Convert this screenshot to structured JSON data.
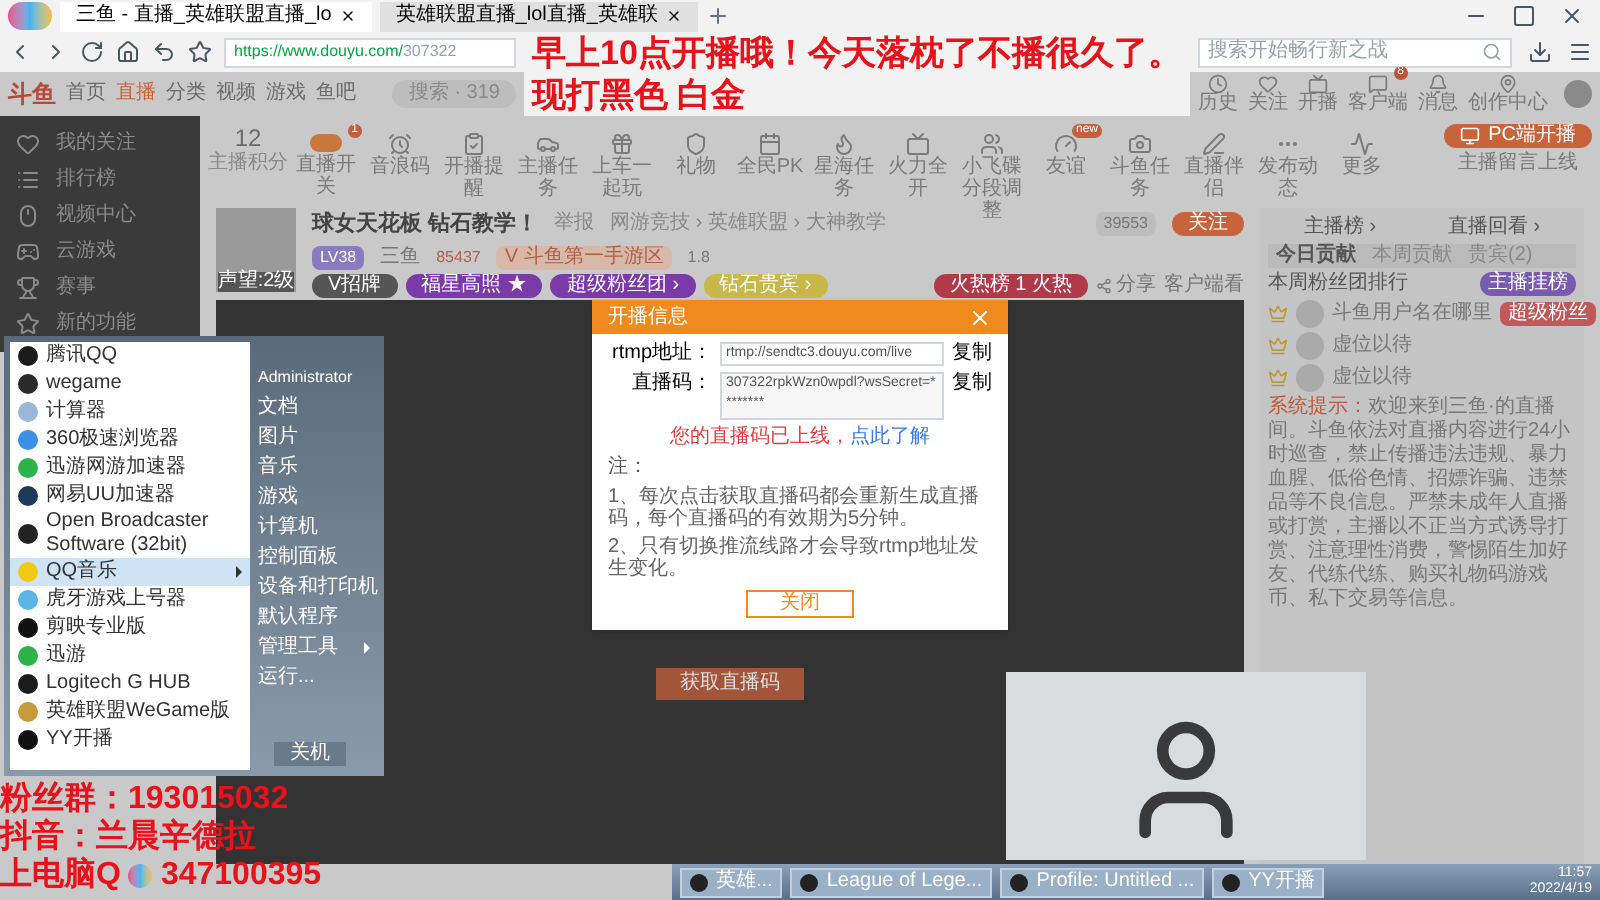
{
  "browser": {
    "tabs": [
      {
        "label": "三鱼 - 直播_英雄联盟直播_lo",
        "selected": true
      },
      {
        "label": "英雄联盟直播_lol直播_英雄联",
        "selected": false
      }
    ],
    "address_host": "https://www.douyu.com/",
    "address_path": "307322",
    "search_placeholder": "搜索开始畅行新之战"
  },
  "site": {
    "logo": "斗鱼",
    "nav": [
      {
        "label": "首页",
        "selected": false
      },
      {
        "label": "直播",
        "selected": true
      },
      {
        "label": "分类",
        "selected": false
      },
      {
        "label": "视频",
        "selected": false
      },
      {
        "label": "游戏",
        "selected": false
      },
      {
        "label": "鱼吧",
        "selected": false
      }
    ],
    "search_placeholder": "搜索 · 319",
    "user_tools": [
      {
        "label": "历史"
      },
      {
        "label": "关注"
      },
      {
        "label": "开播"
      },
      {
        "label": "客户端",
        "badge": "8"
      },
      {
        "label": "消息"
      },
      {
        "label": "创作中心"
      }
    ]
  },
  "sidebar": [
    "我的关注",
    "排行榜",
    "视频中心",
    "云游戏",
    "赛事",
    "新的功能"
  ],
  "points": {
    "value": "12",
    "label": "主播积分"
  },
  "tools": [
    {
      "kind": "toggle",
      "label": "直播开关",
      "badge": "1"
    },
    {
      "kind": "icon",
      "label": "音浪码"
    },
    {
      "kind": "icon",
      "label": "开播提醒"
    },
    {
      "kind": "icon",
      "label": "主播任务"
    },
    {
      "kind": "icon",
      "label": "上车一起玩"
    },
    {
      "kind": "icon",
      "label": "礼物"
    },
    {
      "kind": "icon",
      "label": "全民PK"
    },
    {
      "kind": "icon",
      "label": "星海任务"
    },
    {
      "kind": "icon",
      "label": "火力全开"
    },
    {
      "kind": "icon",
      "label": "小飞碟分段调整"
    },
    {
      "kind": "icon",
      "label": "友谊",
      "badge": "new"
    },
    {
      "kind": "icon",
      "label": "斗鱼任务"
    },
    {
      "kind": "icon",
      "label": "直播伴侣"
    },
    {
      "kind": "icon",
      "label": "发布动态"
    },
    {
      "kind": "icon",
      "label": "更多"
    }
  ],
  "pc_button": "PC端开播",
  "pc_note": "主播留言上线",
  "streamer": {
    "title": "球女天花板 钻石教学！",
    "report": "举报",
    "category": "网游竞技 › 英雄联盟 › 大神教学",
    "level": "LV38",
    "name": "三鱼",
    "hot": "85437",
    "rank": "V 斗鱼第一手游区",
    "viewers": "1.8",
    "avatar_caption": "声望:2级",
    "tags": [
      "V招牌",
      "福星高照 ★",
      "超级粉丝团 ›",
      "钻石贵宾 ›"
    ],
    "followers": "39553",
    "follow": "关注",
    "hot_rank_label": "火热榜",
    "hot_rank_num": "1",
    "hot_rank_suffix": "火热",
    "share": "分享",
    "client": "客户端看"
  },
  "start_button_behind": "获取直播码",
  "right_panel": {
    "tabs_top": [
      "主播榜 ›",
      "直播回看 ›"
    ],
    "tabs": [
      {
        "label": "今日贡献",
        "selected": true
      },
      {
        "label": "本周贡献",
        "selected": false
      },
      {
        "label": "贵宾(2)",
        "selected": false
      }
    ],
    "fan_heading": "本周粉丝团排行",
    "fans": [
      {
        "name": "斗鱼用户名在哪里",
        "badge": "超级粉丝"
      },
      {
        "name": "虚位以待"
      },
      {
        "name": "虚位以待"
      }
    ],
    "notice_label": "系统提示：",
    "notice": "欢迎来到三鱼·的直播间。斗鱼依法对直播内容进行24小时巡查，禁止传播违法违规、暴力血腥、低俗色情、招嫖诈骗、违禁品等不良信息。严禁未成年人直播或打赏，主播以不正当方式诱导打赏、注意理性消费，警惕陌生加好友、代练代练、购买礼物码游戏币、私下交易等信息。",
    "promo": "主播挂榜"
  },
  "dialog": {
    "title": "开播信息",
    "rtmp_label": "rtmp地址：",
    "rtmp_value": "rtmp://sendtc3.douyu.com/live",
    "code_label": "直播码：",
    "code_value": "307322rpkWzn0wpdl?wsSecret=********",
    "rtmp_copy": "复制",
    "code_copy": "复制",
    "warning": "您的直播码已上线，",
    "warning_link": "点此了解",
    "note_title": "注：",
    "notes": [
      "1、每次点击获取直播码都会重新生成直播码，每个直播码的有效期为5分钟。",
      "2、只有切换推流线路才会导致rtmp地址发生变化。"
    ],
    "close": "关闭"
  },
  "start_menu": {
    "programs": [
      {
        "name": "腾讯QQ",
        "color": "#1a1a1a",
        "selected": false,
        "submenu": false
      },
      {
        "name": "wegame",
        "color": "#2b2b2b",
        "selected": false,
        "submenu": false
      },
      {
        "name": "计算器",
        "color": "#9ab8d8",
        "selected": false,
        "submenu": false
      },
      {
        "name": "360极速浏览器",
        "color": "#3c8ee8",
        "selected": false,
        "submenu": false
      },
      {
        "name": "迅游网游加速器",
        "color": "#2fb24a",
        "selected": false,
        "submenu": false
      },
      {
        "name": "网易UU加速器",
        "color": "#1d3b58",
        "selected": false,
        "submenu": false
      },
      {
        "name": "Open Broadcaster Software (32bit)",
        "color": "#222222",
        "selected": false,
        "submenu": false
      },
      {
        "name": "QQ音乐",
        "color": "#f2c811",
        "selected": true,
        "submenu": true
      },
      {
        "name": "虎牙游戏上号器",
        "color": "#5ab4e8",
        "selected": false,
        "submenu": false
      },
      {
        "name": "剪映专业版",
        "color": "#111111",
        "selected": false,
        "submenu": false
      },
      {
        "name": "迅游",
        "color": "#2fb24a",
        "selected": false,
        "submenu": false
      },
      {
        "name": "Logitech G HUB",
        "color": "#1b1b1b",
        "selected": false,
        "submenu": false
      },
      {
        "name": "英雄联盟WeGame版",
        "color": "#c49a3a",
        "selected": false,
        "submenu": false
      },
      {
        "name": "YY开播",
        "color": "#111111",
        "selected": false,
        "submenu": false
      }
    ],
    "user": "Administrator",
    "places": [
      {
        "label": "文档",
        "submenu": false
      },
      {
        "label": "图片",
        "submenu": false
      },
      {
        "label": "音乐",
        "submenu": false
      },
      {
        "label": "游戏",
        "submenu": false
      },
      {
        "label": "计算机",
        "submenu": false
      },
      {
        "label": "控制面板",
        "submenu": false
      },
      {
        "label": "设备和打印机",
        "submenu": false
      },
      {
        "label": "默认程序",
        "submenu": false
      },
      {
        "label": "管理工具",
        "submenu": true
      },
      {
        "label": "运行...",
        "submenu": false
      }
    ],
    "shutdown": "关机"
  },
  "overlay": {
    "top": [
      "早上10点开播哦！今天落枕了不播很久了。",
      "现打黑色 白金"
    ],
    "fans_group": "粉丝群：193015032",
    "douyin": "抖音：兰晨辛德拉",
    "qq_prefix": "上电脑Q",
    "qq_number": "347100395"
  },
  "taskbar": {
    "items": [
      "英雄...",
      "League of Lege...",
      "Profile: Untitled ...",
      "YY开播"
    ],
    "time": "11:57",
    "date": "2022/4/19"
  }
}
